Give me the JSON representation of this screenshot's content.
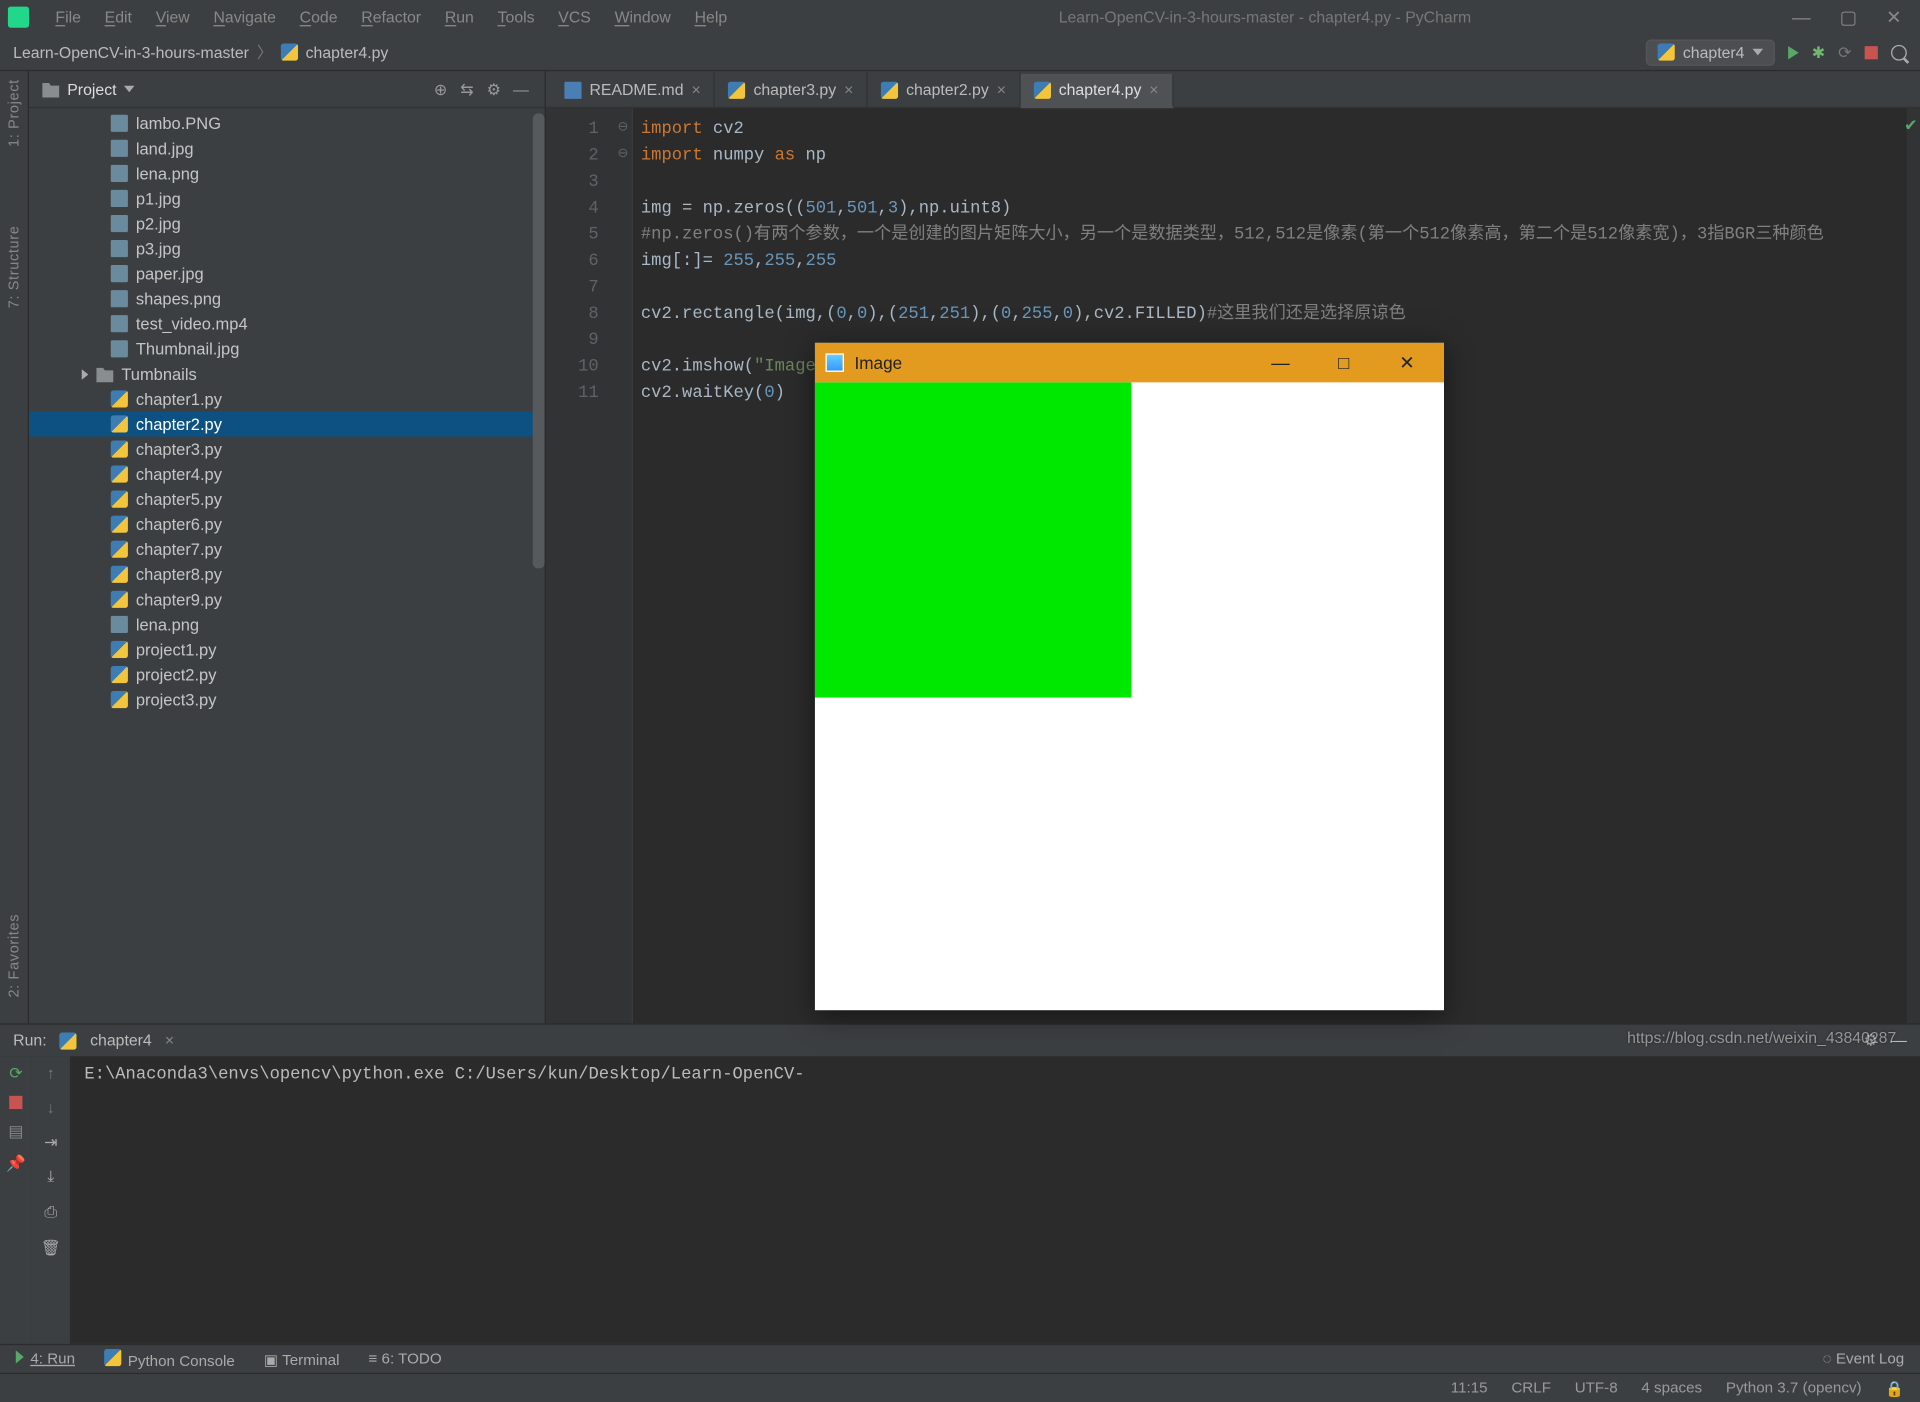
{
  "window": {
    "title": "Learn-OpenCV-in-3-hours-master - chapter4.py - PyCharm"
  },
  "menu": [
    "File",
    "Edit",
    "View",
    "Navigate",
    "Code",
    "Refactor",
    "Run",
    "Tools",
    "VCS",
    "Window",
    "Help"
  ],
  "breadcrumb": {
    "root": "Learn-OpenCV-in-3-hours-master",
    "file": "chapter4.py"
  },
  "run_config": {
    "label": "chapter4"
  },
  "project_panel": {
    "title": "Project"
  },
  "tree": [
    {
      "t": "file",
      "name": "lambo.PNG"
    },
    {
      "t": "file",
      "name": "land.jpg"
    },
    {
      "t": "file",
      "name": "lena.png"
    },
    {
      "t": "file",
      "name": "p1.jpg"
    },
    {
      "t": "file",
      "name": "p2.jpg"
    },
    {
      "t": "file",
      "name": "p3.jpg"
    },
    {
      "t": "file",
      "name": "paper.jpg"
    },
    {
      "t": "file",
      "name": "shapes.png"
    },
    {
      "t": "file",
      "name": "test_video.mp4"
    },
    {
      "t": "file",
      "name": "Thumbnail.jpg"
    },
    {
      "t": "folder",
      "name": "Tumbnails"
    },
    {
      "t": "py",
      "name": "chapter1.py"
    },
    {
      "t": "py",
      "name": "chapter2.py",
      "sel": true
    },
    {
      "t": "py",
      "name": "chapter3.py"
    },
    {
      "t": "py",
      "name": "chapter4.py"
    },
    {
      "t": "py",
      "name": "chapter5.py"
    },
    {
      "t": "py",
      "name": "chapter6.py"
    },
    {
      "t": "py",
      "name": "chapter7.py"
    },
    {
      "t": "py",
      "name": "chapter8.py"
    },
    {
      "t": "py",
      "name": "chapter9.py"
    },
    {
      "t": "file",
      "name": "lena.png"
    },
    {
      "t": "py",
      "name": "project1.py"
    },
    {
      "t": "py",
      "name": "project2.py"
    },
    {
      "t": "py",
      "name": "project3.py"
    }
  ],
  "tabs": [
    {
      "name": "README.md",
      "icon": "md"
    },
    {
      "name": "chapter3.py",
      "icon": "py"
    },
    {
      "name": "chapter2.py",
      "icon": "py"
    },
    {
      "name": "chapter4.py",
      "icon": "py",
      "active": true
    }
  ],
  "code": {
    "lines": [
      {
        "n": 1,
        "html": "<span class='kw'>import</span> cv2"
      },
      {
        "n": 2,
        "html": "<span class='kw'>import</span> numpy <span class='kw'>as</span> np"
      },
      {
        "n": 3,
        "html": ""
      },
      {
        "n": 4,
        "html": "img = np.zeros((<span class='num'>501</span>,<span class='num'>501</span>,<span class='num'>3</span>),np.uint8)"
      },
      {
        "n": 5,
        "html": "<span class='cm'>#np.zeros()有两个参数，一个是创建的图片矩阵大小，另一个是数据类型，512,512是像素(第一个512像素高，第二个是512像素宽)，3指BGR三种颜色</span>"
      },
      {
        "n": 6,
        "html": "img[:]= <span class='num'>255</span>,<span class='num'>255</span>,<span class='num'>255</span>"
      },
      {
        "n": 7,
        "html": ""
      },
      {
        "n": 8,
        "html": "cv2.rectangle(img,(<span class='num'>0</span>,<span class='num'>0</span>),(<span class='num'>251</span>,<span class='num'>251</span>),(<span class='num'>0</span>,<span class='num'>255</span>,<span class='num'>0</span>),cv2.FILLED)<span class='cm'>#这里我们还是选择原谅色</span>"
      },
      {
        "n": 9,
        "html": ""
      },
      {
        "n": 10,
        "html": "cv2.imshow(<span class='str'>\"Image\"</span>,"
      },
      {
        "n": 11,
        "html": "cv2.waitKey(<span class='num'>0</span>)"
      }
    ]
  },
  "run_tab": {
    "label": "Run:",
    "name": "chapter4"
  },
  "console_out": "E:\\Anaconda3\\envs\\opencv\\python.exe C:/Users/kun/Desktop/Learn-OpenCV-",
  "bottom_tools": {
    "run": "4: Run",
    "pyconsole": "Python Console",
    "terminal": "Terminal",
    "todo": "6: TODO",
    "eventlog": "Event Log"
  },
  "status": {
    "pos": "11:15",
    "eol": "CRLF",
    "enc": "UTF-8",
    "indent": "4 spaces",
    "interp": "Python 3.7 (opencv)"
  },
  "image_window": {
    "title": "Image"
  },
  "watermark": "https://blog.csdn.net/weixin_43840287",
  "sidestrip": {
    "project": "1: Project",
    "structure": "7: Structure",
    "favorites": "2: Favorites"
  }
}
